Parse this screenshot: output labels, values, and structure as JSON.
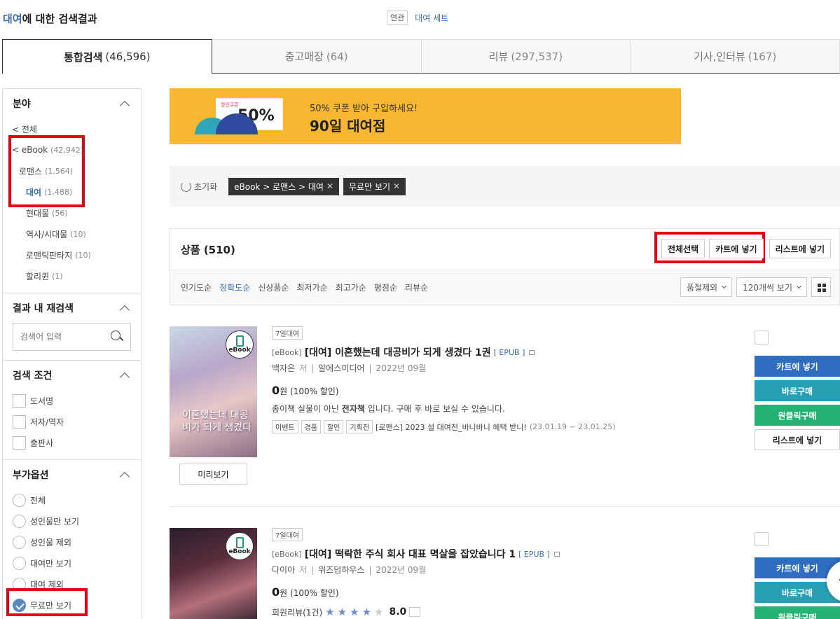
{
  "header": {
    "keyword": "대여",
    "title_suffix": "에 대한 검색결과",
    "related_tag": "연관",
    "related_link": "대여 세트"
  },
  "tabs": [
    {
      "label": "통합검색",
      "count": "(46,596)",
      "active": true
    },
    {
      "label": "중고매장",
      "count": "(64)"
    },
    {
      "label": "리뷰",
      "count": "(297,537)"
    },
    {
      "label": "기사,인터뷰",
      "count": "(167)"
    }
  ],
  "sidebar": {
    "category": {
      "title": "분야",
      "items": [
        {
          "label": "< 전체",
          "count": ""
        },
        {
          "label": "< eBook",
          "count": "(42,942)"
        },
        {
          "label": "로맨스",
          "count": "(1,564)"
        },
        {
          "label": "대여",
          "count": "(1,488)"
        },
        {
          "label": "현대물",
          "count": "(56)"
        },
        {
          "label": "역사/시대물",
          "count": "(10)"
        },
        {
          "label": "로맨틱판타지",
          "count": "(10)"
        },
        {
          "label": "할리퀸",
          "count": "(1)"
        }
      ]
    },
    "research": {
      "title": "결과 내 재검색",
      "placeholder": "검색어 입력"
    },
    "conditions": {
      "title": "검색 조건",
      "items": [
        "도서명",
        "저자/역자",
        "출판사"
      ]
    },
    "options": {
      "title": "부가옵션",
      "items": [
        "전체",
        "성인물만 보기",
        "성인물 제외",
        "대여만 보기",
        "대여 제외",
        "무료만 보기"
      ],
      "selected": "무료만 보기"
    }
  },
  "banner": {
    "coupon_label": "할인쿠폰",
    "coupon_pct": "50%",
    "line1": "50% 쿠폰 받아 구입하세요!",
    "line2": "90일 대여점"
  },
  "filters": {
    "reset": "초기화",
    "chips": [
      "eBook > 로맨스 > 대여",
      "무료만 보기"
    ]
  },
  "products": {
    "header": "상품 (510)",
    "select_all": "전체선택",
    "add_cart": "카트에 넣기",
    "add_list": "리스트에 넣기",
    "sorts": [
      "인기도순",
      "정확도순",
      "신상품순",
      "최저가순",
      "최고가순",
      "평점순",
      "리뷰순"
    ],
    "active_sort": "정확도순",
    "soldout_filter": "품절제외",
    "per_page": "120개씩 보기"
  },
  "items": [
    {
      "rent_tag": "7일대여",
      "format": "[eBook]",
      "title": "[대여] 이혼했는데 대공비가 되게 생겼다 1권",
      "ebook_type": "[ EPUB ]",
      "author": "백자은",
      "author_role": "저",
      "publisher": "알에스미디어",
      "date": "2022년 09월",
      "price": "0",
      "price_unit": "원",
      "discount": "(100% 할인)",
      "desc_pre": "종이책 실물이 아닌 ",
      "desc_bold": "전자책",
      "desc_post": " 입니다. 구매 후 바로 보실 수 있습니다.",
      "tags": [
        "이벤트",
        "경품",
        "할인",
        "기획전"
      ],
      "event_text": "[로맨스] 2023 설 대여전_바니바니 혜택 받니!",
      "event_date": "(23.01.19 ~ 23.01.25)",
      "cover_text": "이혼했는데 대공비가 되게 생겼다",
      "preview": "미리보기",
      "badge": "eBook"
    },
    {
      "rent_tag": "7일대여",
      "format": "[eBook]",
      "title": "[대여] 떡락한 주식 회사 대표 멱살을 잡았습니다 1",
      "ebook_type": "[ EPUB ]",
      "author": "다이아",
      "author_role": "저",
      "publisher": "위즈덤하우스",
      "date": "2022년 09월",
      "price": "0",
      "price_unit": "원",
      "discount": "(100% 할인)",
      "review_label": "회원리뷰(1건)",
      "rating": 4,
      "score": "8.0",
      "badge": "eBook"
    }
  ],
  "actions": {
    "cart": "카트에 넣기",
    "buy": "바로구매",
    "oneclick": "원클릭구매",
    "list": "리스트에 넣기"
  },
  "colors": {
    "accent_blue": "#3a6fb0",
    "cart": "#2e6dc0",
    "buy": "#27a0b6",
    "oneclick": "#23b273",
    "highlight": "#e60012",
    "banner": "#f7b731"
  }
}
